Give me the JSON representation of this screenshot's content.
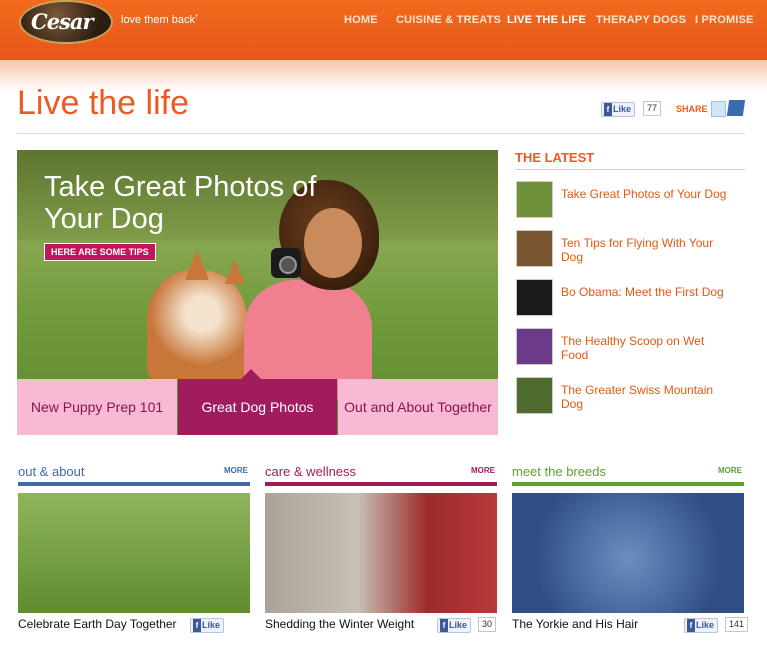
{
  "header": {
    "logo_text": "Cesar",
    "tagline": "love them back",
    "tagline_mark": "†",
    "nav": [
      "HOME",
      "CUISINE & TREATS",
      "LIVE THE LIFE",
      "THERAPY DOGS",
      "I PROMISE"
    ],
    "active_nav": "LIVE THE LIFE"
  },
  "page": {
    "title": "Live the life",
    "like_label": "Like",
    "like_count": "77",
    "share_label": "SHARE"
  },
  "hero": {
    "headline": "Take Great Photos of Your Dog",
    "cta": "HERE ARE SOME TIPS",
    "tabs": [
      "New Puppy Prep 101",
      "Great Dog Photos",
      "Out and About Together"
    ],
    "active_tab": "Great Dog Photos"
  },
  "latest": {
    "title": "THE LATEST",
    "items": [
      {
        "label": "Take Great Photos of Your Dog",
        "thumb": "#6f8f3a"
      },
      {
        "label": "Ten Tips for Flying With Your Dog",
        "thumb": "#7a5632"
      },
      {
        "label": "Bo Obama: Meet the First Dog",
        "thumb": "#1a1a1a"
      },
      {
        "label": "The Healthy Scoop on Wet Food",
        "thumb": "#6b3b8a"
      },
      {
        "label": "The Greater Swiss Mountain Dog",
        "thumb": "#4f6b2d"
      }
    ]
  },
  "sections": [
    {
      "title": "out & about",
      "more": "MORE",
      "color": "#3f6aa8",
      "caption": "Celebrate Earth Day Together",
      "like": "Like",
      "count": ""
    },
    {
      "title": "care & wellness",
      "more": "MORE",
      "color": "#a11c5c",
      "caption": "Shedding the Winter Weight",
      "like": "Like",
      "count": "30"
    },
    {
      "title": "meet the breeds",
      "more": "MORE",
      "color": "#5fa033",
      "caption": "The Yorkie and His Hair",
      "like": "Like",
      "count": "141"
    }
  ],
  "colors": {
    "brand_orange": "#ee5a24",
    "magenta": "#a11c5c",
    "pink": "#f7b9d4"
  }
}
